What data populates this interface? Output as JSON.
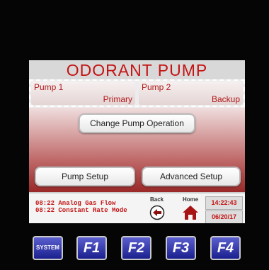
{
  "title": "ODORANT PUMP",
  "pumps": [
    {
      "name": "Pump 1",
      "role": "Primary"
    },
    {
      "name": "Pump 2",
      "role": "Backup"
    }
  ],
  "buttons": {
    "change_pump_operation": "Change Pump Operation",
    "pump_setup": "Pump Setup",
    "advanced_setup": "Advanced Setup"
  },
  "status": {
    "messages": [
      "08:22 Analog Gas Flow",
      "08:22 Constant Rate Mode"
    ],
    "back_label": "Back",
    "home_label": "Home",
    "time": "14:22:43",
    "date": "06/20/17"
  },
  "function_keys": [
    "SYSTEM",
    "F1",
    "F2",
    "F3",
    "F4"
  ],
  "colors": {
    "accent": "#c41414",
    "key_blue": "#1a1f8e"
  }
}
